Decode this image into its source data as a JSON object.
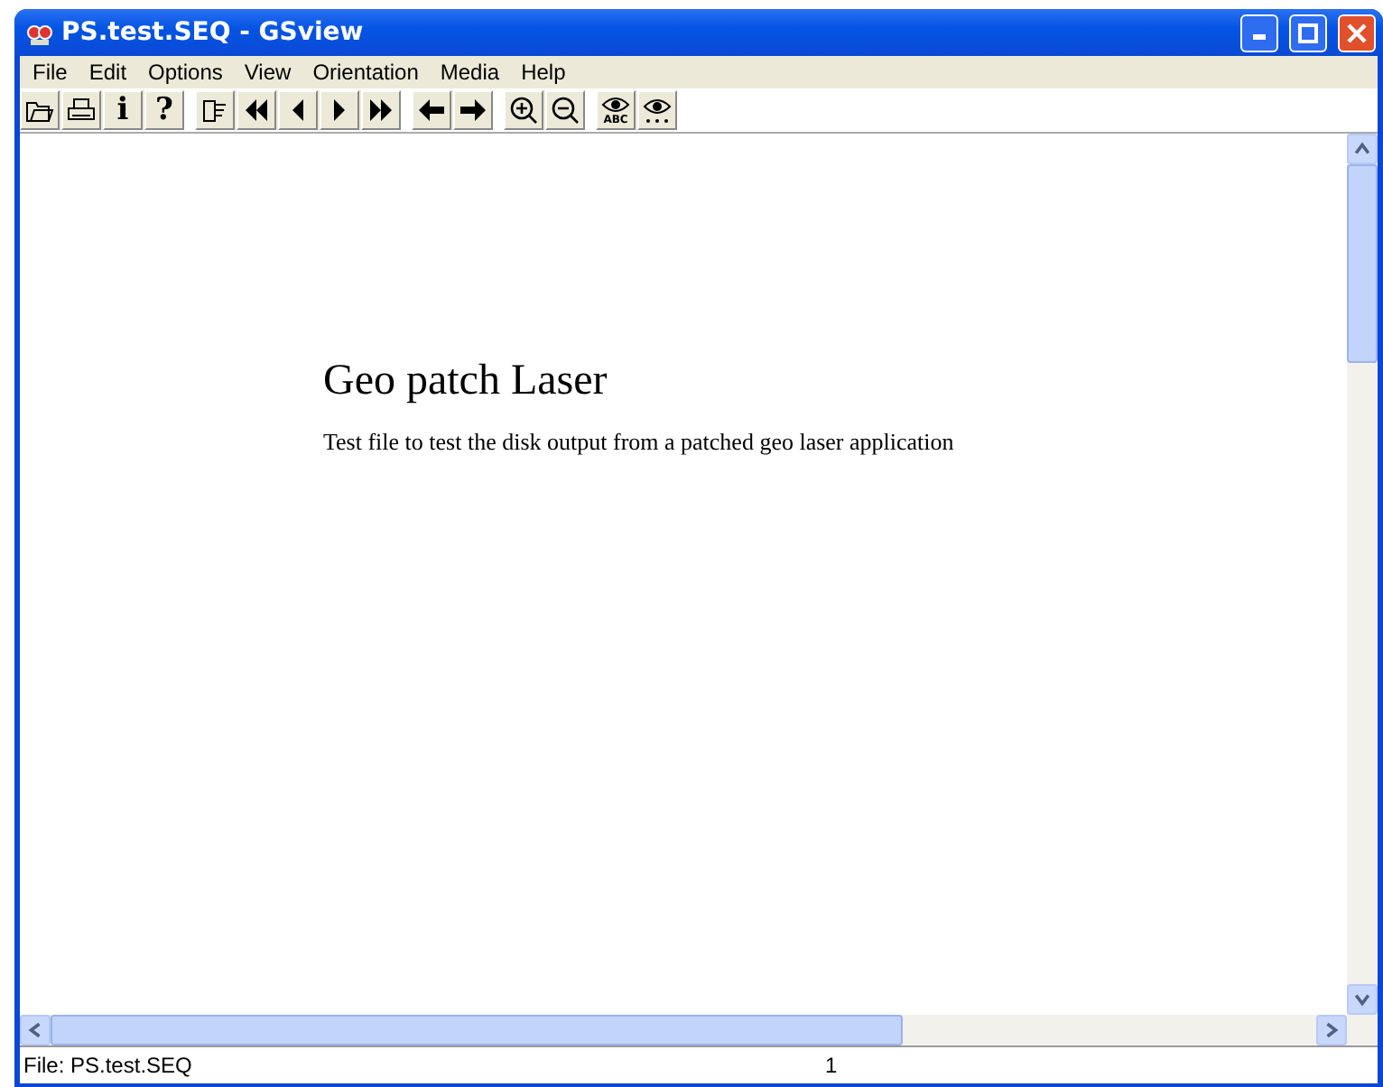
{
  "window": {
    "title": "PS.test.SEQ - GSview"
  },
  "menu": [
    "File",
    "Edit",
    "Options",
    "View",
    "Orientation",
    "Media",
    "Help"
  ],
  "toolbar": [
    [
      {
        "kind": "open"
      },
      {
        "kind": "print"
      },
      {
        "kind": "char",
        "text": "i"
      },
      {
        "kind": "char",
        "text": "?"
      }
    ],
    [
      {
        "kind": "hand"
      },
      {
        "kind": "first"
      },
      {
        "kind": "prev"
      },
      {
        "kind": "next"
      },
      {
        "kind": "last"
      }
    ],
    [
      {
        "kind": "back"
      },
      {
        "kind": "forward"
      }
    ],
    [
      {
        "kind": "zoomin"
      },
      {
        "kind": "zoomout"
      }
    ],
    [
      {
        "kind": "eye",
        "text": "ABC"
      },
      {
        "kind": "eyedots"
      }
    ]
  ],
  "document": {
    "heading": "Geo patch Laser",
    "body": "Test file to test the disk output from a patched geo laser application"
  },
  "status_bar": {
    "file": "File: PS.test.SEQ",
    "page": "1"
  }
}
